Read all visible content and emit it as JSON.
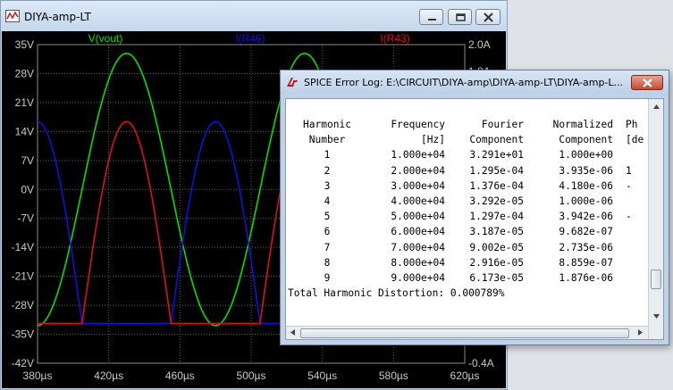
{
  "plot_window": {
    "title": "DIYA-amp-LT",
    "icon": "ltspice-waveform-icon"
  },
  "error_log": {
    "title": "SPICE Error Log: E:\\CIRCUIT\\DIYA-amp\\DIYA-amp-LT\\DIYA-amp-L...",
    "icon": "ltspice-logo-icon",
    "headers": {
      "line1": {
        "harmonic": "Harmonic",
        "frequency": "Frequency",
        "fourier": "Fourier",
        "normalized": "Normalized",
        "phase": "Ph"
      },
      "line2": {
        "harmonic": "Number",
        "frequency": "[Hz]",
        "fourier": "Component",
        "normalized": "Component",
        "phase": "[de"
      }
    },
    "rows": [
      {
        "n": "1",
        "freq": "1.000e+04",
        "fourier": "3.291e+01",
        "norm": "1.000e+00",
        "phase": ""
      },
      {
        "n": "2",
        "freq": "2.000e+04",
        "fourier": "1.295e-04",
        "norm": "3.935e-06",
        "phase": "1"
      },
      {
        "n": "3",
        "freq": "3.000e+04",
        "fourier": "1.376e-04",
        "norm": "4.180e-06",
        "phase": "-"
      },
      {
        "n": "4",
        "freq": "4.000e+04",
        "fourier": "3.292e-05",
        "norm": "1.000e-06",
        "phase": ""
      },
      {
        "n": "5",
        "freq": "5.000e+04",
        "fourier": "1.297e-04",
        "norm": "3.942e-06",
        "phase": "-"
      },
      {
        "n": "6",
        "freq": "6.000e+04",
        "fourier": "3.187e-05",
        "norm": "9.682e-07",
        "phase": ""
      },
      {
        "n": "7",
        "freq": "7.000e+04",
        "fourier": "9.002e-05",
        "norm": "2.735e-06",
        "phase": ""
      },
      {
        "n": "8",
        "freq": "8.000e+04",
        "fourier": "2.916e-05",
        "norm": "8.859e-07",
        "phase": ""
      },
      {
        "n": "9",
        "freq": "9.000e+04",
        "fourier": "6.173e-05",
        "norm": "1.876e-06",
        "phase": ""
      }
    ],
    "thd": "Total Harmonic Distortion: 0.000789%"
  },
  "chart_data": {
    "type": "line",
    "title": "",
    "xlabel": "",
    "ylabel": "",
    "grid": true,
    "background": "#000000",
    "xlim": [
      380,
      620
    ],
    "ylim": [
      -42,
      35
    ],
    "y2lim": [
      -0.4,
      2.0
    ],
    "x_ticks": [
      "380µs",
      "420µs",
      "460µs",
      "500µs",
      "540µs",
      "580µs",
      "620µs"
    ],
    "y_ticks": [
      "35V",
      "28V",
      "21V",
      "14V",
      "7V",
      "0V",
      "-7V",
      "-14V",
      "-21V",
      "-28V",
      "-35V",
      "-42V"
    ],
    "y2_ticks": [
      "2.0A",
      "1.8A",
      "-0.4A"
    ],
    "legend_placement": "top",
    "series": [
      {
        "name": "V(vout)",
        "color": "#00e000",
        "axis": "left",
        "shape": "sine",
        "amplitude": 32.9,
        "offset": 0,
        "period": 100,
        "peak_at": 430
      },
      {
        "name": "I(R46)",
        "color": "#1010e0",
        "axis": "right",
        "shape": "half-wave",
        "amplitude": 1.52,
        "floor": -0.1,
        "period": 100,
        "peak_at": 480
      },
      {
        "name": "I(R43)",
        "color": "#e01010",
        "axis": "right",
        "shape": "half-wave",
        "amplitude": 1.52,
        "floor": -0.1,
        "period": 100,
        "peak_at": 430
      }
    ]
  }
}
